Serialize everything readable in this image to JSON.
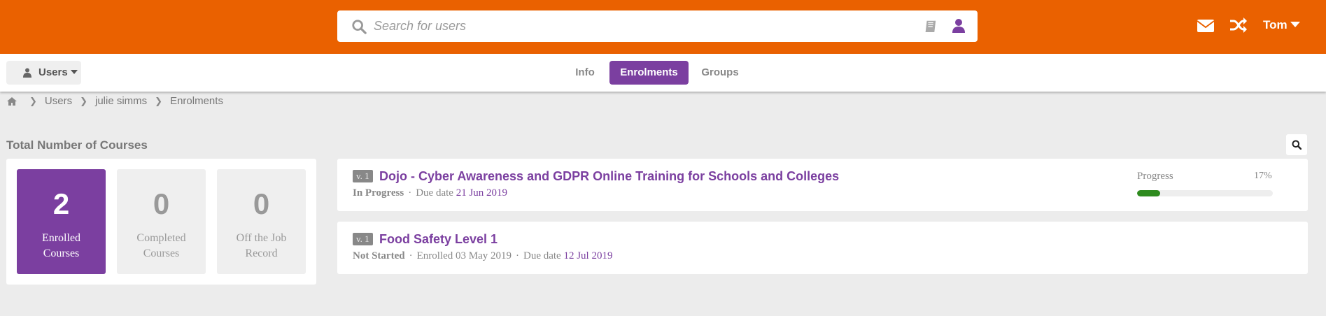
{
  "header": {
    "search_placeholder": "Search for users",
    "user_name": "Tom",
    "icons": [
      "search-icon",
      "book-icon",
      "user-icon",
      "envelope-icon",
      "shuffle-icon"
    ]
  },
  "subnav": {
    "users_label": "Users",
    "tabs": [
      {
        "label": "Info",
        "active": false
      },
      {
        "label": "Enrolments",
        "active": true
      },
      {
        "label": "Groups",
        "active": false
      }
    ]
  },
  "breadcrumb": [
    "Users",
    "julie simms",
    "Enrolments"
  ],
  "summary": {
    "title": "Total Number of Courses",
    "stats": [
      {
        "value": "2",
        "label": "Enrolled Courses",
        "active": true
      },
      {
        "value": "0",
        "label": "Completed Courses",
        "active": false
      },
      {
        "value": "0",
        "label": "Off the Job Record",
        "active": false
      }
    ]
  },
  "courses": [
    {
      "version": "v. 1",
      "title": "Dojo - Cyber Awareness and GDPR Online Training for Schools and Colleges",
      "status": "In Progress",
      "due_label": "Due date",
      "due_date": "21 Jun 2019",
      "progress_label": "Progress",
      "progress_pct": "17%",
      "progress_value": 0.17
    },
    {
      "version": "v. 1",
      "title": "Food Safety Level 1",
      "status": "Not Started",
      "enrolled": "Enrolled 03 May 2019",
      "due_label": "Due date",
      "due_date": "12 Jul 2019"
    }
  ],
  "colors": {
    "brand_orange": "#ea6100",
    "accent_purple": "#7b3fa0",
    "progress_green": "#2e8b1e"
  }
}
